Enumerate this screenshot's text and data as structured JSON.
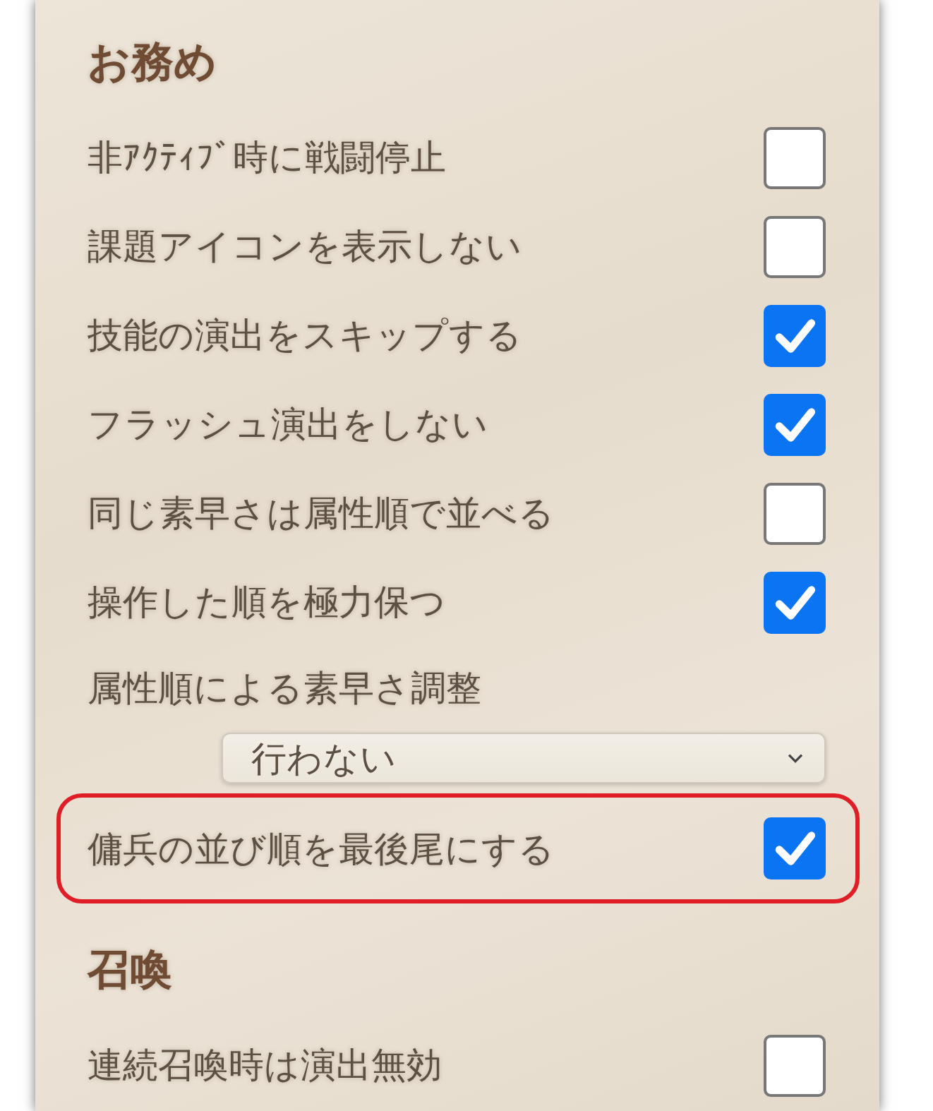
{
  "sections": [
    {
      "title": "お務め",
      "items": [
        {
          "kind": "checkbox",
          "label": "非ｱｸﾃｨﾌﾞ時に戦闘停止",
          "checked": false,
          "highlighted": false
        },
        {
          "kind": "checkbox",
          "label": "課題アイコンを表示しない",
          "checked": false,
          "highlighted": false
        },
        {
          "kind": "checkbox",
          "label": "技能の演出をスキップする",
          "checked": true,
          "highlighted": false
        },
        {
          "kind": "checkbox",
          "label": "フラッシュ演出をしない",
          "checked": true,
          "highlighted": false
        },
        {
          "kind": "checkbox",
          "label": "同じ素早さは属性順で並べる",
          "checked": false,
          "highlighted": false
        },
        {
          "kind": "checkbox",
          "label": "操作した順を極力保つ",
          "checked": true,
          "highlighted": false
        },
        {
          "kind": "select",
          "label": "属性順による素早さ調整",
          "value": "行わない",
          "highlighted": false
        },
        {
          "kind": "checkbox",
          "label": "傭兵の並び順を最後尾にする",
          "checked": true,
          "highlighted": true
        }
      ]
    },
    {
      "title": "召喚",
      "items": [
        {
          "kind": "checkbox",
          "label": "連続召喚時は演出無効",
          "checked": false,
          "highlighted": false
        }
      ]
    }
  ]
}
